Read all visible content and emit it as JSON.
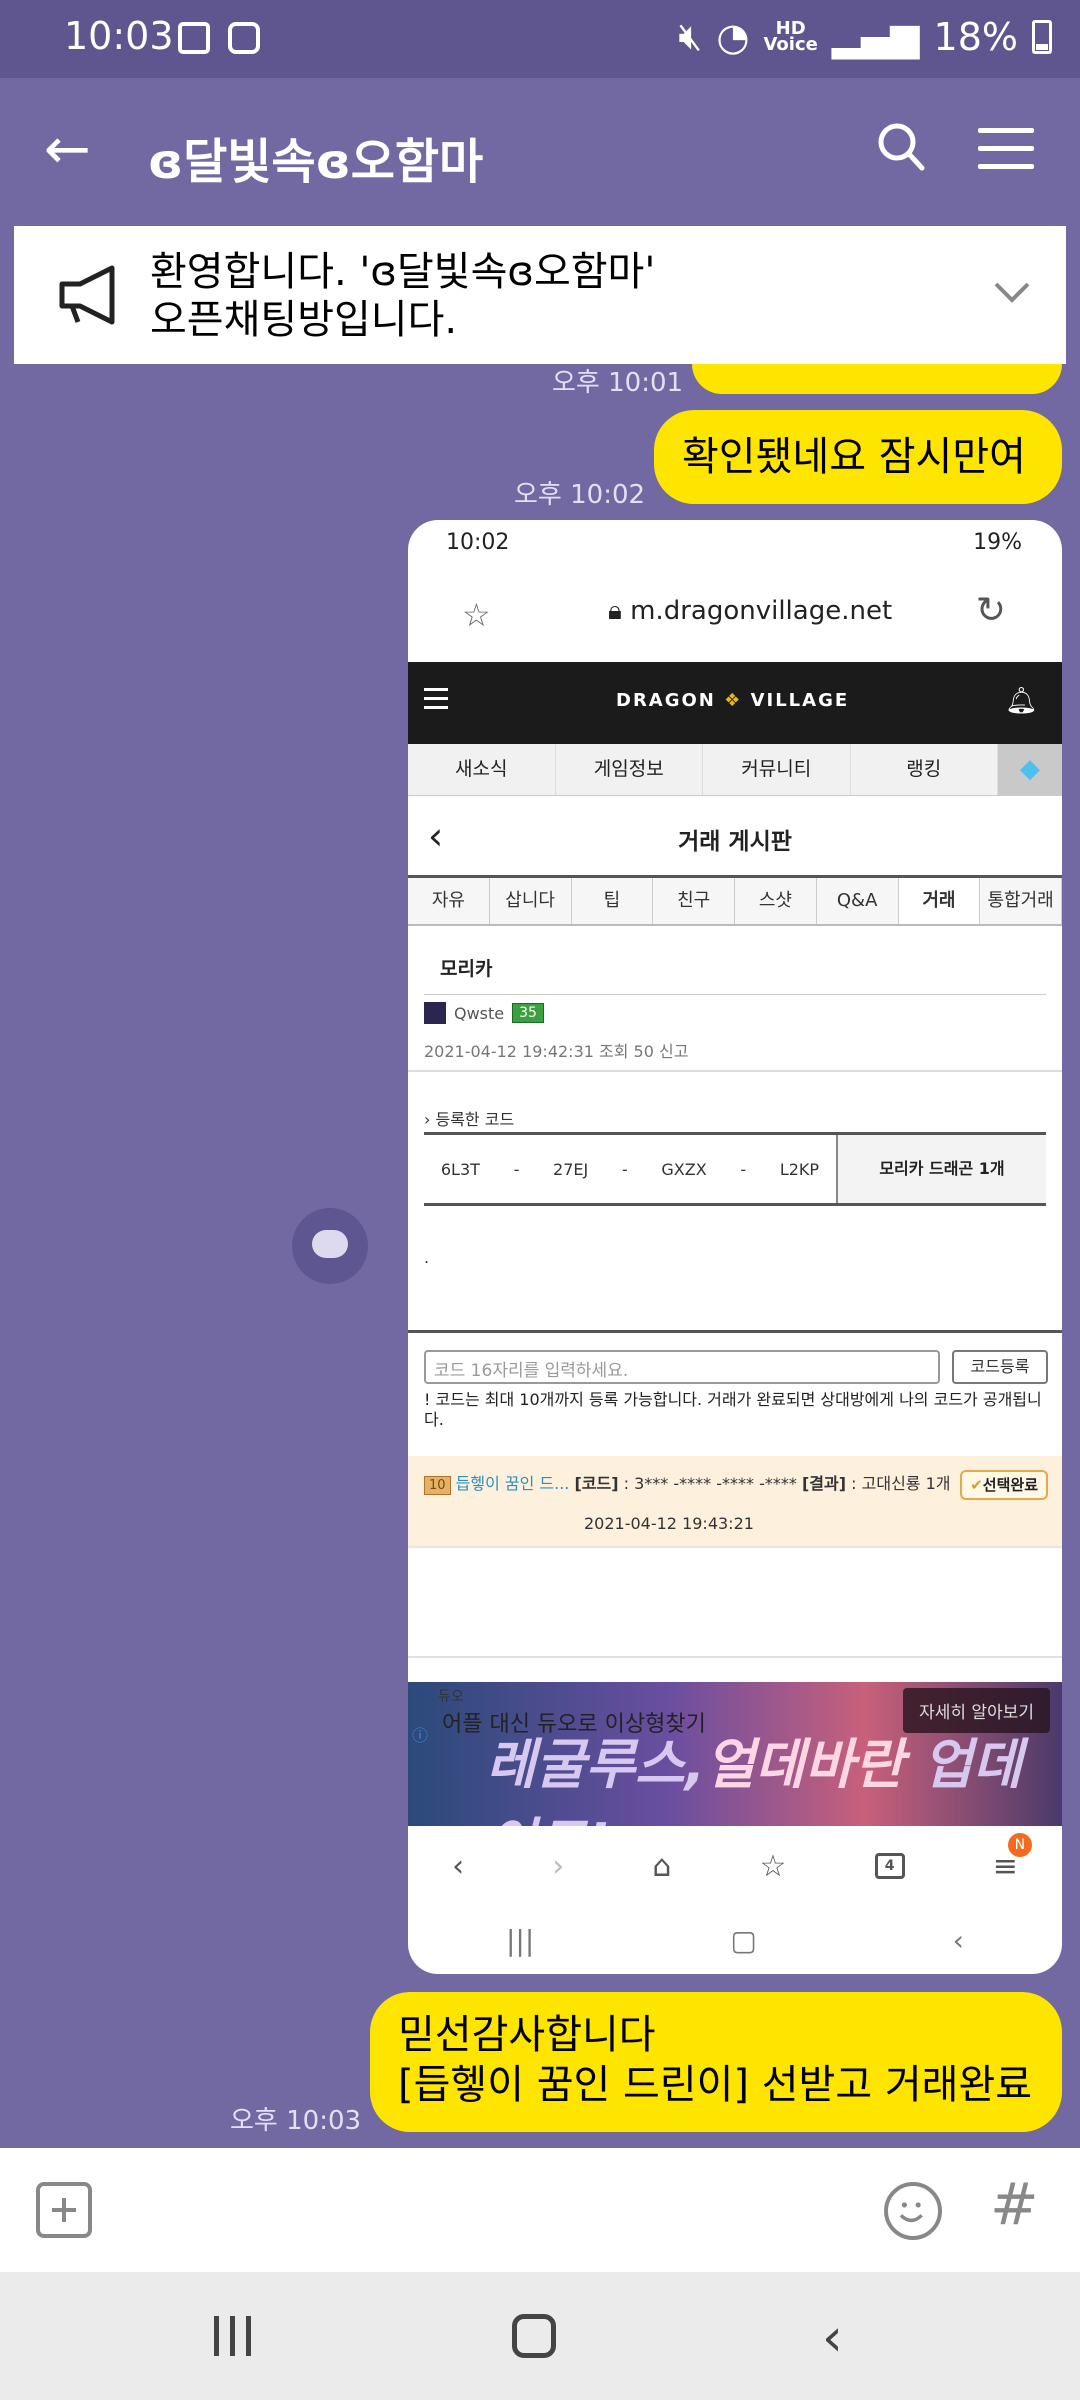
{
  "status_bar": {
    "time": "10:03",
    "battery": "18%",
    "hd_line1": "HD",
    "hd_line2": "Voice"
  },
  "header": {
    "title": "ɞ달빛속ɞ오함마"
  },
  "notice": {
    "line1": "환영합니다. 'ɞ달빛속ɞ오함마'",
    "line2": "오픈채팅방입니다."
  },
  "chat": [
    {
      "time": "오후 10:01",
      "text": ""
    },
    {
      "time": "오후 10:02",
      "text": "확인됐네요 잠시만여"
    },
    {
      "time": "오후 10:03",
      "line1": "믿선감사합니다",
      "line2": "[듭헿이 꿈인 드린이] 선받고 거래완료"
    }
  ],
  "screenshot": {
    "status_time": "10:02",
    "status_battery": "19%",
    "url": "m.dragonvillage.net",
    "logo_left": "DRAGON",
    "logo_right": "VILLAGE",
    "categories": [
      "새소식",
      "게임정보",
      "커뮤니티",
      "랭킹"
    ],
    "board_title": "거래 게시판",
    "sub_tabs": [
      "자유",
      "삽니다",
      "팁",
      "친구",
      "스샷",
      "Q&A",
      "거래",
      "통합거래"
    ],
    "post": {
      "title": "모리카",
      "author": "Qwste",
      "level": "35",
      "meta": "2021-04-12 19:42:31  조회 50  신고",
      "code_header": "› 등록한 코드",
      "codes": [
        "6L3T",
        "-",
        "27EJ",
        "-",
        "GXZX",
        "-",
        "L2KP"
      ],
      "reward": "모리카 드래곤 1개",
      "body": "."
    },
    "register": {
      "placeholder": "코드 16자리를 입력하세요.",
      "button": "코드등록",
      "note": "! 코드는 최대 10개까지 등록 가능합니다. 거래가 완료되면 상대방에게 나의 코드가 공개됩니다."
    },
    "deal": {
      "level": "10",
      "nick": "듭헿이 꿈인 드...",
      "code_label": "[코드]",
      "code_value": " : 3*** -**** -**** -****",
      "result_label": "[결과]",
      "result_value": " : 고대신룡 1개",
      "status": "선택완료",
      "datetime": "2021-04-12 19:43:21"
    },
    "ad": {
      "label": "듀오",
      "caption": "어플 대신 듀오로 이상형찾기",
      "more": "자세히 알아보기",
      "headline_a": "레굴루스,",
      "headline_b": "얼데바란",
      "headline_c": " 업데이트!"
    },
    "tab_count": "4",
    "badge": "N"
  },
  "colors": {
    "bubble": "#fee500",
    "background": "#7269a3",
    "header": "#5f5690"
  }
}
